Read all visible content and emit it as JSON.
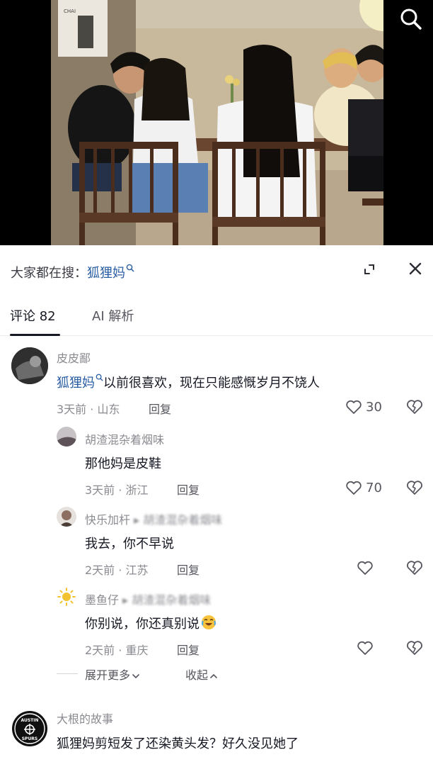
{
  "search_bar": {
    "prefix": "大家都在搜：",
    "term": "狐狸妈"
  },
  "tabs": [
    {
      "label": "评论 82"
    },
    {
      "label": "AI 解析"
    }
  ],
  "comments": [
    {
      "username": "皮皮鄙",
      "link": "狐狸妈",
      "text": "以前很喜欢，现在只能感慨岁月不饶人",
      "meta": "3天前 · 山东",
      "reply": "回复",
      "likes": "30"
    },
    {
      "username": "胡渣混杂着烟味",
      "text": "那他妈是皮鞋",
      "meta": "3天前 · 浙江",
      "reply": "回复",
      "likes": "70"
    },
    {
      "username": "快乐加杆",
      "reply_to": "胡渣混杂着烟味",
      "text": "我去，你不早说",
      "meta": "2天前 · 江苏",
      "reply": "回复",
      "likes": ""
    },
    {
      "username": "墨鱼仔",
      "reply_to": "胡渣混杂着烟味",
      "text": "你别说，你还真别说",
      "meta": "2天前 · 重庆",
      "reply": "回复",
      "likes": ""
    },
    {
      "username": "大根的故事",
      "text": "狐狸妈剪短发了还染黄头发？好久没见她了"
    }
  ],
  "thread_controls": {
    "expand_more": "展开更多",
    "collapse": "收起"
  },
  "avatar_badge": {
    "top": "AUSTIN",
    "bottom": "SPURS"
  },
  "colors": {
    "link": "#2a5ea3",
    "secondary_text": "#8a8b91",
    "primary_text": "#161823"
  }
}
